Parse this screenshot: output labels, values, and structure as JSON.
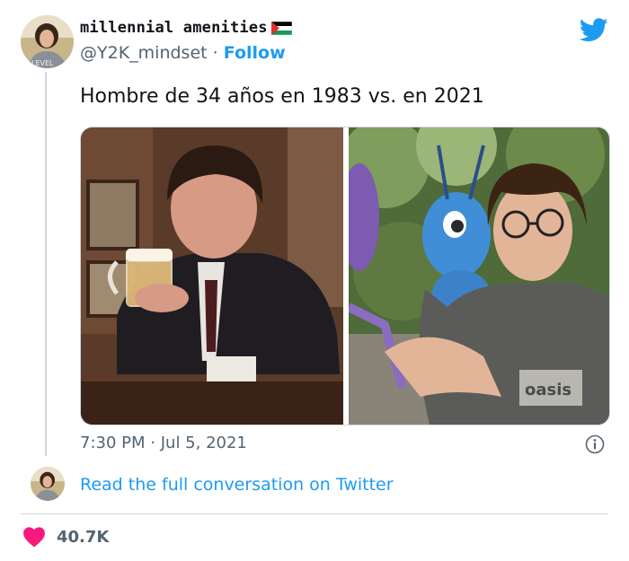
{
  "tweet": {
    "display_name": "millennial amenities",
    "handle": "@Y2K_mindset",
    "separator": "·",
    "follow_label": "Follow",
    "text": "Hombre de 34 años en 1983 vs. en 2021",
    "time": "7:30 PM",
    "date": "Jul 5, 2021",
    "avatar_text": "LEVEL",
    "shirt_text": "oasis"
  },
  "footer": {
    "read_link": "Read the full conversation on Twitter",
    "like_count": "40.7K"
  },
  "icons": {
    "flag": "palestine-flag-icon",
    "brand": "twitter-bird-icon",
    "info": "info-icon",
    "like": "heart-icon"
  },
  "colors": {
    "accent": "#1d9bf0",
    "like": "#f91880",
    "secondary_text": "#536471",
    "divider": "#cfd9de"
  }
}
